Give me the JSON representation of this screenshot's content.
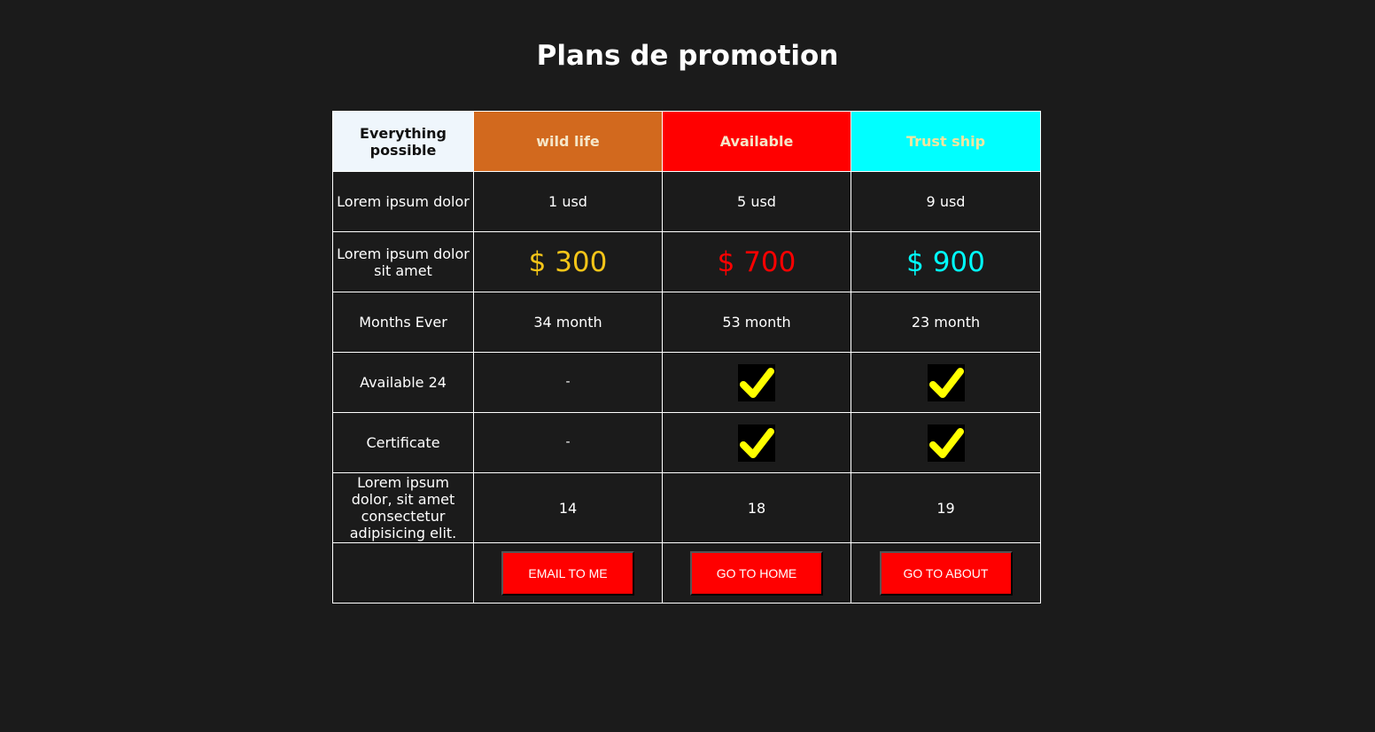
{
  "page": {
    "title": "Plans de promotion"
  },
  "colors": {
    "background": "#1b1b1b",
    "wild_life": "#d2691e",
    "available": "#ff0000",
    "trust_ship": "#00ffff",
    "price_wild": "#f5c518",
    "price_available": "#ff0000",
    "price_trust": "#00ffff",
    "check": "#ffff00",
    "button": "#ff0000"
  },
  "table": {
    "header": {
      "corner": "Everything possible",
      "plans": [
        "wild life",
        "Available",
        "Trust ship"
      ]
    },
    "rows": [
      {
        "label": "Lorem ipsum dolor",
        "values": [
          "1 usd",
          "5 usd",
          "9 usd"
        ]
      },
      {
        "label": "Lorem ipsum dolor sit amet",
        "values": [
          "$ 300",
          "$ 700",
          "$ 900"
        ]
      },
      {
        "label": "Months Ever",
        "values": [
          "34 month",
          "53 month",
          "23 month"
        ]
      },
      {
        "label": "Available 24",
        "values": [
          "-",
          "check-icon",
          "check-icon"
        ]
      },
      {
        "label": "Certificate",
        "values": [
          "-",
          "check-icon",
          "check-icon"
        ]
      },
      {
        "label": "Lorem ipsum dolor, sit amet consectetur adipisicing elit.",
        "values": [
          "14",
          "18",
          "19"
        ]
      }
    ],
    "buttons": [
      "EMAIL TO ME",
      "GO TO HOME",
      "GO TO ABOUT"
    ]
  }
}
